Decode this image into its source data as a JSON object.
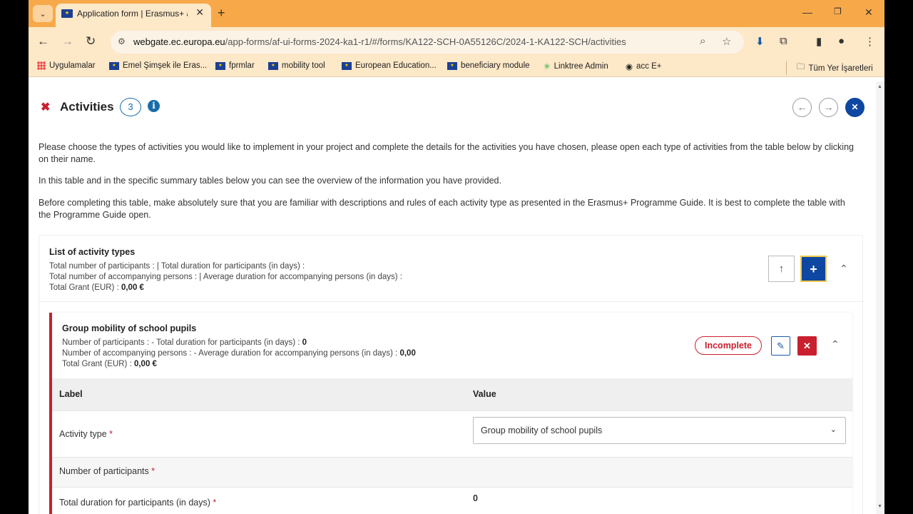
{
  "browser": {
    "tab_title": "Application form | Erasmus+ an",
    "url_host": "webgate.ec.europa.eu",
    "url_path": "/app-forms/af-ui-forms-2024-ka1-r1/#/forms/KA122-SCH-0A55126C/2024-1-KA122-SCH/activities"
  },
  "bookmarks": [
    {
      "label": "Uygulamalar",
      "icon": "apps-grid-icon"
    },
    {
      "label": "Emel Şimşek ile Eras...",
      "icon": "eu-flag-icon"
    },
    {
      "label": "fprmlar",
      "icon": "eu-flag-icon"
    },
    {
      "label": "mobility tool",
      "icon": "eu-flag-icon"
    },
    {
      "label": "European Education...",
      "icon": "eu-flag-icon"
    },
    {
      "label": "beneficiary module",
      "icon": "eu-flag-icon"
    },
    {
      "label": "Linktree Admin",
      "icon": "linktree-icon"
    },
    {
      "label": "acc E+",
      "icon": "globe-icon"
    },
    {
      "label": "Tüm Yer İşaretleri",
      "icon": "folder-icon"
    }
  ],
  "header": {
    "title": "Activities",
    "count": "3"
  },
  "intro": {
    "p1": "Please choose the types of activities you would like to implement in your project and complete the details for the activities you have chosen, please open each type of activities from the table below by clicking on their name.",
    "p2": "In this table and in the specific summary tables below you can see the overview of the information you have provided.",
    "p3": "Before completing this table, make absolutely sure that you are familiar with descriptions and rules of each activity type as presented in the Erasmus+ Programme Guide. It is best to complete the table with the Programme Guide open."
  },
  "list": {
    "title": "List of activity types",
    "line1": "Total number of participants :  | Total duration for participants (in days) :",
    "line2": "Total number of accompanying persons :  | Average duration for accompanying persons (in days) :",
    "line3_label": "Total Grant (EUR) : ",
    "line3_value": "0,00 €"
  },
  "activity": {
    "title": "Group mobility of school pupils",
    "line1_label": "Number of participants :  - Total duration for participants (in days) : ",
    "line1_value": "0",
    "line2_label": "Number of accompanying persons :  - Average duration for accompanying persons (in days) : ",
    "line2_value": "0,00",
    "line3_label": "Total Grant (EUR) : ",
    "line3_value": "0,00 €",
    "status": "Incomplete",
    "table": {
      "col_label": "Label",
      "col_value": "Value",
      "rows": [
        {
          "label": "Activity type",
          "value": "Group mobility of school pupils"
        },
        {
          "label": "Number of participants",
          "value": ""
        },
        {
          "label": "Total duration for participants (in days)",
          "value": "0"
        }
      ],
      "required_marker": "*"
    }
  },
  "colors": {
    "accent": "#0e47a1",
    "danger": "#c8202f",
    "tabbar": "#f7a94a"
  }
}
